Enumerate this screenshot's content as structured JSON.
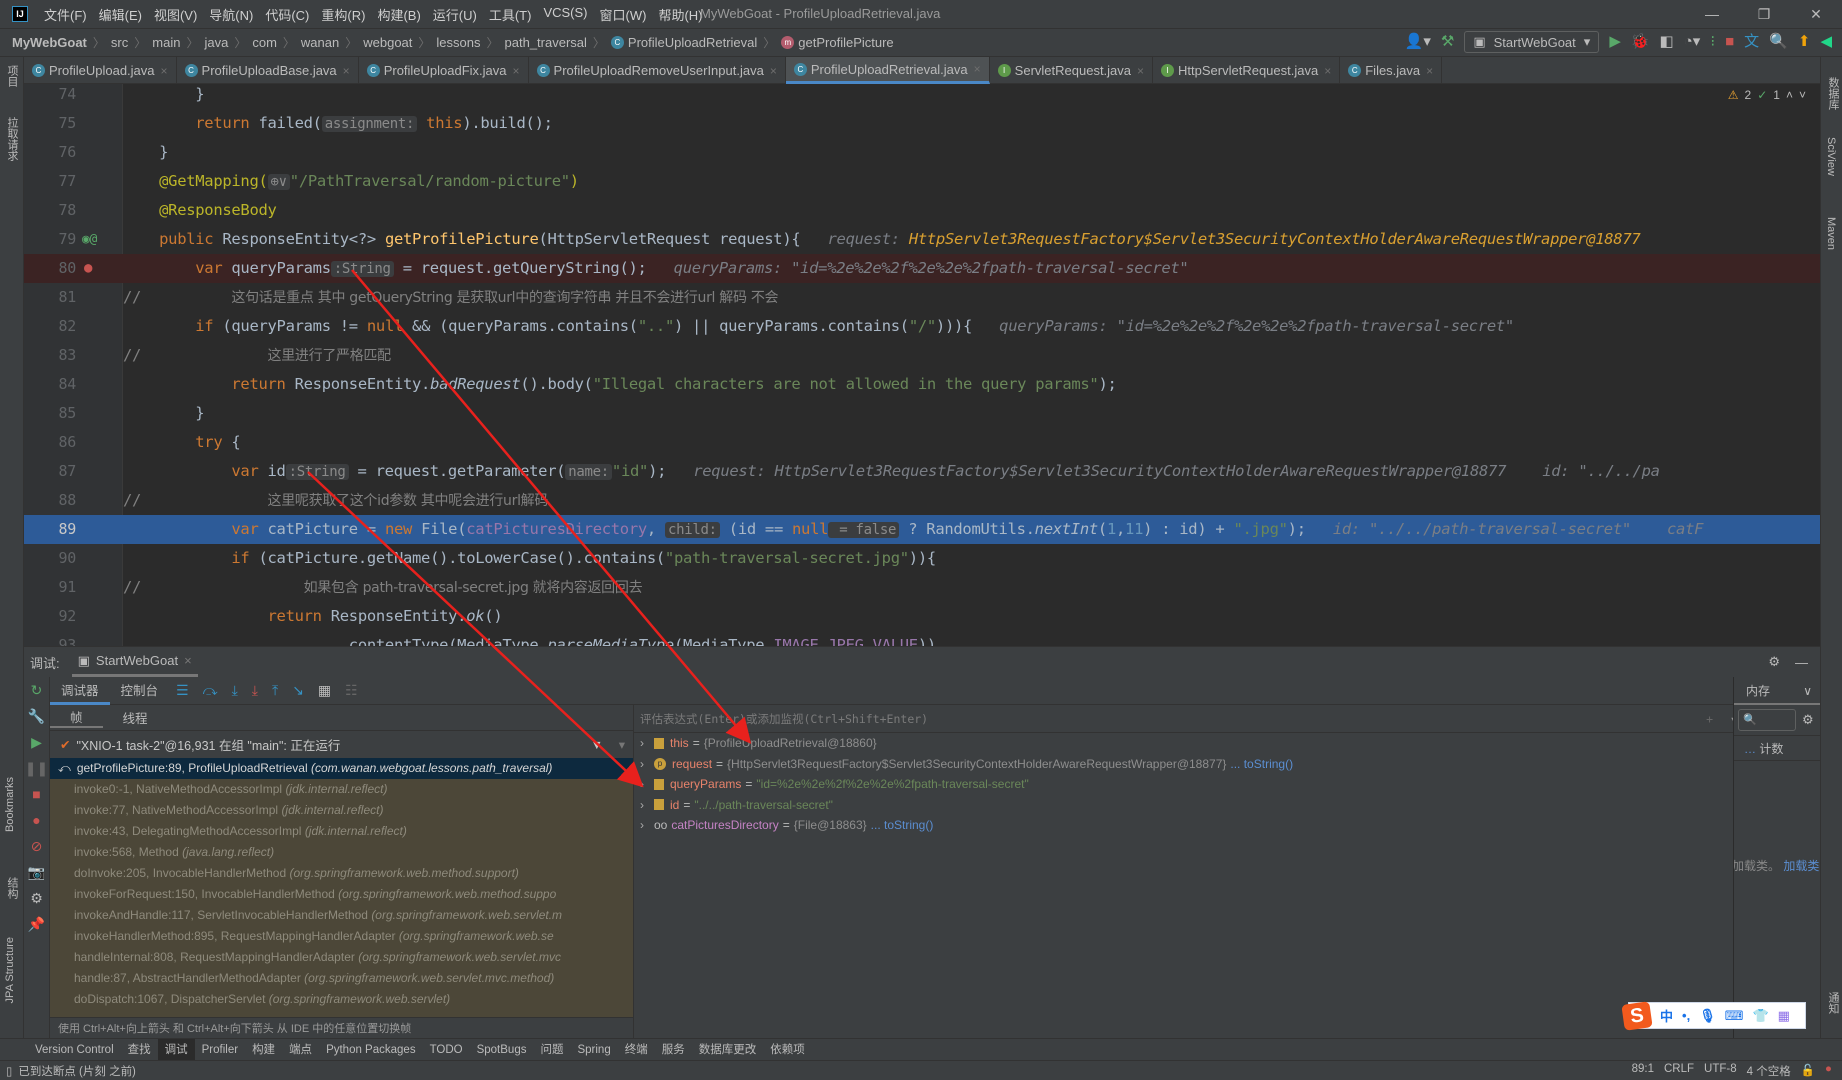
{
  "titlebar": {
    "menus": [
      "文件(F)",
      "编辑(E)",
      "视图(V)",
      "导航(N)",
      "代码(C)",
      "重构(R)",
      "构建(B)",
      "运行(U)",
      "工具(T)",
      "VCS(S)",
      "窗口(W)",
      "帮助(H)"
    ],
    "title": "MyWebGoat - ProfileUploadRetrieval.java",
    "logo": "IJ"
  },
  "breadcrumb": [
    "MyWebGoat",
    "src",
    "main",
    "java",
    "com",
    "wanan",
    "webgoat",
    "lessons",
    "path_traversal",
    "ProfileUploadRetrieval",
    "getProfilePicture"
  ],
  "run_config": "StartWebGoat",
  "tabs": [
    {
      "label": "ProfileUpload.java",
      "icon": "class-icon"
    },
    {
      "label": "ProfileUploadBase.java",
      "icon": "class-icon"
    },
    {
      "label": "ProfileUploadFix.java",
      "icon": "class-icon"
    },
    {
      "label": "ProfileUploadRemoveUserInput.java",
      "icon": "class-icon"
    },
    {
      "label": "ProfileUploadRetrieval.java",
      "icon": "class-icon",
      "active": true
    },
    {
      "label": "ServletRequest.java",
      "icon": "interface-icon"
    },
    {
      "label": "HttpServletRequest.java",
      "icon": "interface-icon"
    },
    {
      "label": "Files.java",
      "icon": "class-icon"
    }
  ],
  "left_strip": [
    "项目",
    "拉取请求",
    "Bookmarks",
    "结构",
    "JPA Structure"
  ],
  "right_strip": [
    "数据库",
    "SciView",
    "Maven",
    "通知"
  ],
  "inspections": {
    "warnings": "2",
    "ok": "1"
  },
  "code_lines": [
    {
      "num": "74",
      "tokens": [
        [
          "n",
          "        }"
        ]
      ]
    },
    {
      "num": "75",
      "tokens": [
        [
          "k",
          "        return "
        ],
        [
          "n",
          "failed("
        ],
        [
          "h",
          "assignment:"
        ],
        [
          "k",
          " this"
        ],
        [
          "n",
          ").build();"
        ]
      ]
    },
    {
      "num": "76",
      "tokens": [
        [
          "n",
          "    }"
        ]
      ]
    },
    {
      "num": "77",
      "tokens": [
        [
          "a",
          "    @GetMapping("
        ],
        [
          "h",
          "⊕∨"
        ],
        [
          "s",
          "\"/PathTraversal/random-picture\""
        ],
        [
          "a",
          ")"
        ]
      ]
    },
    {
      "num": "78",
      "tokens": [
        [
          "a",
          "    @ResponseBody"
        ]
      ]
    },
    {
      "num": "79",
      "tokens": [
        [
          "k",
          "    public "
        ],
        [
          "n",
          "ResponseEntity<?> "
        ],
        [
          "f",
          "getProfilePicture"
        ],
        [
          "n",
          "(HttpServletRequest request){   "
        ],
        [
          "v",
          "request: "
        ],
        [
          "vo",
          "HttpServlet3RequestFactory$Servlet3SecurityContextHolderAwareRequestWrapper@18877"
        ]
      ]
    },
    {
      "num": "80",
      "cls": "bp",
      "tokens": [
        [
          "k",
          "        var "
        ],
        [
          "n",
          "queryParams"
        ],
        [
          "h",
          ":String"
        ],
        [
          "n",
          " = request.getQueryString();   "
        ],
        [
          "v",
          "queryParams: \"id=%2e%2e%2f%2e%2e%2fpath-traversal-secret\""
        ]
      ]
    },
    {
      "num": "81",
      "tokens": [
        [
          "c",
          "//          "
        ],
        [
          "cm",
          "这句话是重点 其中 getQueryString 是获取url中的查询字符串 并且不会进行url 解码 不会"
        ]
      ]
    },
    {
      "num": "82",
      "tokens": [
        [
          "k",
          "        if "
        ],
        [
          "n",
          "(queryParams != "
        ],
        [
          "k",
          "null "
        ],
        [
          "n",
          "&& (queryParams.contains("
        ],
        [
          "s",
          "\"..\""
        ],
        [
          "n",
          ") || queryParams.contains("
        ],
        [
          "s",
          "\"/\""
        ],
        [
          "n",
          "))){   "
        ],
        [
          "v",
          "queryParams: \"id=%2e%2e%2f%2e%2e%2fpath-traversal-secret\""
        ]
      ]
    },
    {
      "num": "83",
      "tokens": [
        [
          "c",
          "//              "
        ],
        [
          "cm",
          "这里进行了严格匹配"
        ]
      ]
    },
    {
      "num": "84",
      "tokens": [
        [
          "k",
          "            return "
        ],
        [
          "n",
          "ResponseEntity."
        ],
        [
          "st",
          "badRequest"
        ],
        [
          "n",
          "().body("
        ],
        [
          "s",
          "\"Illegal characters are not allowed in the query params\""
        ],
        [
          "n",
          ");"
        ]
      ]
    },
    {
      "num": "85",
      "tokens": [
        [
          "n",
          "        }"
        ]
      ]
    },
    {
      "num": "86",
      "tokens": [
        [
          "k",
          "        try "
        ],
        [
          "n",
          "{"
        ]
      ]
    },
    {
      "num": "87",
      "tokens": [
        [
          "k",
          "            var "
        ],
        [
          "n",
          "id"
        ],
        [
          "h",
          ":String"
        ],
        [
          "n",
          " = request.getParameter("
        ],
        [
          "h",
          "name:"
        ],
        [
          "s",
          "\"id\""
        ],
        [
          "n",
          ");   "
        ],
        [
          "v",
          "request: HttpServlet3RequestFactory$Servlet3SecurityContextHolderAwareRequestWrapper@18877    id: \"../../pa"
        ]
      ]
    },
    {
      "num": "88",
      "tokens": [
        [
          "c",
          "//              "
        ],
        [
          "cm",
          "这里呢获取了这个id参数 其中呢会进行url解码"
        ]
      ]
    },
    {
      "num": "89",
      "cls": "exec",
      "tokens": [
        [
          "k",
          "            var "
        ],
        [
          "n",
          "catPicture = "
        ],
        [
          "k",
          "new "
        ],
        [
          "n",
          "File("
        ],
        [
          "p",
          "catPicturesDirectory"
        ],
        [
          "n",
          ", "
        ],
        [
          "h",
          "child:"
        ],
        [
          "n",
          " (id == "
        ],
        [
          "k",
          "null"
        ],
        [
          "h",
          " = false"
        ],
        [
          "n",
          " ? RandomUtils."
        ],
        [
          "st",
          "nextInt"
        ],
        [
          "n",
          "("
        ],
        [
          "num",
          "1"
        ],
        [
          "n",
          ","
        ],
        [
          "num",
          "11"
        ],
        [
          "n",
          ") : id) + "
        ],
        [
          "s",
          "\".jpg\""
        ],
        [
          "n",
          ");   "
        ],
        [
          "v",
          "id: \"../../path-traversal-secret\"    catF"
        ]
      ]
    },
    {
      "num": "90",
      "tokens": [
        [
          "k",
          "            if "
        ],
        [
          "n",
          "(catPicture.getName().toLowerCase().contains("
        ],
        [
          "s",
          "\"path-traversal-secret.jpg\""
        ],
        [
          "n",
          ")){"
        ]
      ]
    },
    {
      "num": "91",
      "tokens": [
        [
          "c",
          "//                  "
        ],
        [
          "cm",
          "如果包含 path-traversal-secret.jpg 就将内容返回回去"
        ]
      ]
    },
    {
      "num": "92",
      "tokens": [
        [
          "k",
          "                return "
        ],
        [
          "n",
          "ResponseEntity."
        ],
        [
          "st",
          "ok"
        ],
        [
          "n",
          "()"
        ]
      ]
    },
    {
      "num": "93",
      "tokens": [
        [
          "n",
          "                        .contentType(MediaType."
        ],
        [
          "st",
          "parseMediaType"
        ],
        [
          "n",
          "(MediaType."
        ],
        [
          "p",
          "IMAGE_JPEG_VALUE"
        ],
        [
          "n",
          "))"
        ]
      ]
    }
  ],
  "debug": {
    "label": "调试:",
    "session_tab": "StartWebGoat",
    "tabs": [
      "调试器",
      "控制台"
    ],
    "sub_tabs": [
      "帧",
      "线程"
    ],
    "thread": "\"XNIO-1 task-2\"@16,931 在组 \"main\": 正在运行",
    "frames": [
      {
        "m": "getProfilePicture:89, ProfileUploadRetrieval",
        "p": "(com.wanan.webgoat.lessons.path_traversal)",
        "sel": true
      },
      {
        "m": "invoke0:-1, NativeMethodAccessorImpl",
        "p": "(jdk.internal.reflect)"
      },
      {
        "m": "invoke:77, NativeMethodAccessorImpl",
        "p": "(jdk.internal.reflect)"
      },
      {
        "m": "invoke:43, DelegatingMethodAccessorImpl",
        "p": "(jdk.internal.reflect)"
      },
      {
        "m": "invoke:568, Method",
        "p": "(java.lang.reflect)"
      },
      {
        "m": "doInvoke:205, InvocableHandlerMethod",
        "p": "(org.springframework.web.method.support)"
      },
      {
        "m": "invokeForRequest:150, InvocableHandlerMethod",
        "p": "(org.springframework.web.method.suppo"
      },
      {
        "m": "invokeAndHandle:117, ServletInvocableHandlerMethod",
        "p": "(org.springframework.web.servlet.m"
      },
      {
        "m": "invokeHandlerMethod:895, RequestMappingHandlerAdapter",
        "p": "(org.springframework.web.se"
      },
      {
        "m": "handleInternal:808, RequestMappingHandlerAdapter",
        "p": "(org.springframework.web.servlet.mvc"
      },
      {
        "m": "handle:87, AbstractHandlerMethodAdapter",
        "p": "(org.springframework.web.servlet.mvc.method)"
      },
      {
        "m": "doDispatch:1067, DispatcherServlet",
        "p": "(org.springframework.web.servlet)"
      }
    ],
    "frames_hint": "使用 Ctrl+Alt+向上箭头 和 Ctrl+Alt+向下箭头 从 IDE 中的任意位置切换帧",
    "eval_placeholder": "评估表达式(Enter)或添加监视(Ctrl+Shift+Enter)",
    "variables": [
      {
        "name": "this",
        "value": "{ProfileUploadRetrieval@18860}",
        "icon": "field-icon"
      },
      {
        "name": "request",
        "value": "{HttpServlet3RequestFactory$Servlet3SecurityContextHolderAwareRequestWrapper@18877}",
        "link": "... toString()",
        "icon": "parameter-icon"
      },
      {
        "name": "queryParams",
        "value": "\"id=%2e%2e%2f%2e%2e%2fpath-traversal-secret\"",
        "str": true,
        "icon": "field-icon"
      },
      {
        "name": "id",
        "value": "\"../../path-traversal-secret\"",
        "str": true,
        "icon": "field-icon"
      },
      {
        "name": "catPicturesDirectory",
        "value": "{File@18863}",
        "link": "... toString()",
        "icon": "watch-icon",
        "purple": true
      }
    ],
    "memory": {
      "tab": "内存",
      "col": "计数",
      "msg": "加载类。",
      "link": "加载类"
    }
  },
  "toolwindows": [
    "Version Control",
    "查找",
    "调试",
    "Profiler",
    "构建",
    "端点",
    "Python Packages",
    "TODO",
    "SpotBugs",
    "问题",
    "Spring",
    "终端",
    "服务",
    "数据库更改",
    "依赖项"
  ],
  "status": {
    "message": "已到达断点 (片刻 之前)",
    "position": "89:1",
    "line_sep": "CRLF",
    "encoding": "UTF-8",
    "indent": "4 个空格"
  },
  "ime": {
    "mode": "中",
    "punct": "•,"
  },
  "colors": {
    "accent": "#4a88c7",
    "exec_line": "#2d5b98",
    "breakpoint_line": "#3b2323",
    "annotation_arrow": "#e8211d"
  }
}
